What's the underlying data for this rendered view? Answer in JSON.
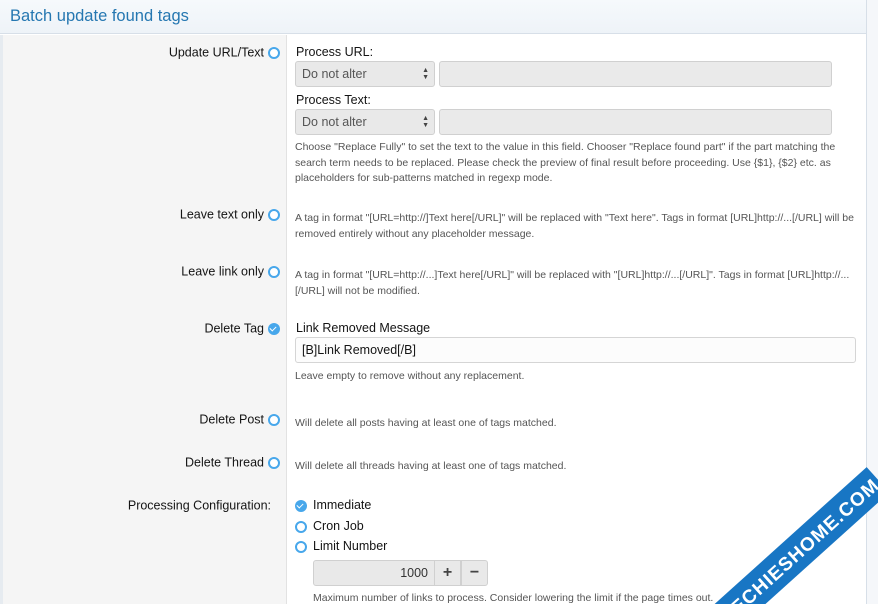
{
  "header": {
    "title": "Batch update found tags"
  },
  "options": {
    "update_url_text": {
      "label": "Update URL/Text",
      "selected": false
    },
    "leave_text_only": {
      "label": "Leave text only",
      "selected": false
    },
    "leave_link_only": {
      "label": "Leave link only",
      "selected": false
    },
    "delete_tag": {
      "label": "Delete Tag",
      "selected": true
    },
    "delete_post": {
      "label": "Delete Post",
      "selected": false
    },
    "delete_thread": {
      "label": "Delete Thread",
      "selected": false
    }
  },
  "process_url": {
    "label": "Process URL:",
    "select_value": "Do not alter",
    "input_value": ""
  },
  "process_text": {
    "label": "Process Text:",
    "select_value": "Do not alter",
    "input_value": ""
  },
  "hints": {
    "update_url_text": "Choose \"Replace Fully\" to set the text to the value in this field. Chooser \"Replace found part\" if the part matching the search term needs to be replaced. Please check the preview of final result before proceeding. Use {$1}, {$2} etc. as placeholders for sub-patterns matched in regexp mode.",
    "leave_text_only": "A tag in format \"[URL=http://]Text here[/URL]\" will be replaced with \"Text here\". Tags in format [URL]http://...[/URL] will be removed entirely without any placeholder message.",
    "leave_link_only": "A tag in format \"[URL=http://...]Text here[/URL]\" will be replaced with \"[URL]http://...[/URL]\". Tags in format [URL]http://...[/URL] will not be modified.",
    "delete_tag": "Leave empty to remove without any replacement.",
    "delete_post": "Will delete all posts having at least one of tags matched.",
    "delete_thread": "Will delete all threads having at least one of tags matched.",
    "limit": "Maximum number of links to process. Consider lowering the limit if the page times out."
  },
  "link_removed_message": {
    "label": "Link Removed Message",
    "value": "[B]Link Removed[/B]"
  },
  "processing": {
    "label": "Processing Configuration:",
    "choices": [
      {
        "label": "Immediate",
        "selected": true
      },
      {
        "label": "Cron Job",
        "selected": false
      },
      {
        "label": "Limit Number",
        "selected": false
      }
    ],
    "limit_value": "1000",
    "plus": "+",
    "minus": "−"
  },
  "watermark": {
    "text": "TECHIESHOME.COM"
  },
  "colors": {
    "accent": "#47a7eb",
    "title": "#2577b1",
    "watermark": "#1876c4"
  },
  "icons": {
    "radio": "radio-circle-icon",
    "radio_checked": "radio-checked-icon",
    "select_arrows": "select-arrows-icon"
  }
}
